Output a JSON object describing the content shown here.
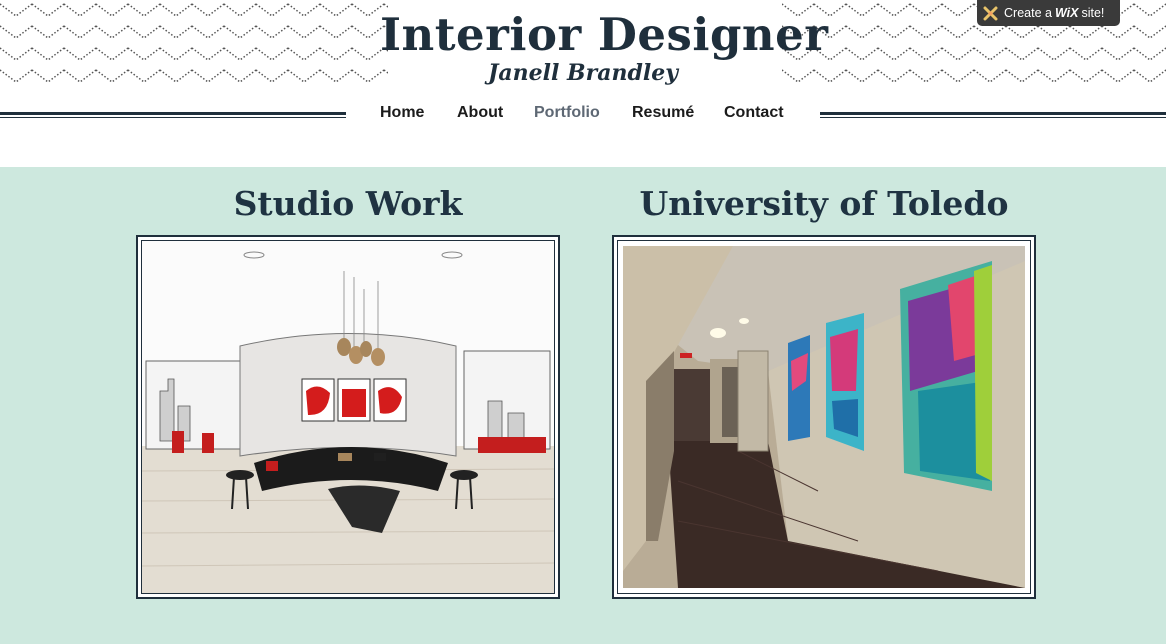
{
  "header": {
    "title": "Interior Designer",
    "subtitle": "Janell Brandley"
  },
  "nav": {
    "items": [
      {
        "label": "Home",
        "active": false
      },
      {
        "label": "About",
        "active": false
      },
      {
        "label": "Portfolio",
        "active": true
      },
      {
        "label": "Resumé",
        "active": false
      },
      {
        "label": "Contact",
        "active": false
      }
    ]
  },
  "wix_badge": {
    "prefix": "Create a",
    "brand": "WiX",
    "suffix": "site!",
    "icon": "wix-logo-icon"
  },
  "gallery": {
    "items": [
      {
        "title": "Studio Work",
        "image": "studio-rendering-image"
      },
      {
        "title": "University of Toledo",
        "image": "hallway-photo-image"
      }
    ]
  },
  "colors": {
    "accent_navy": "#1f2f3c",
    "content_background": "#cde8de",
    "nav_active": "#5e6874"
  }
}
